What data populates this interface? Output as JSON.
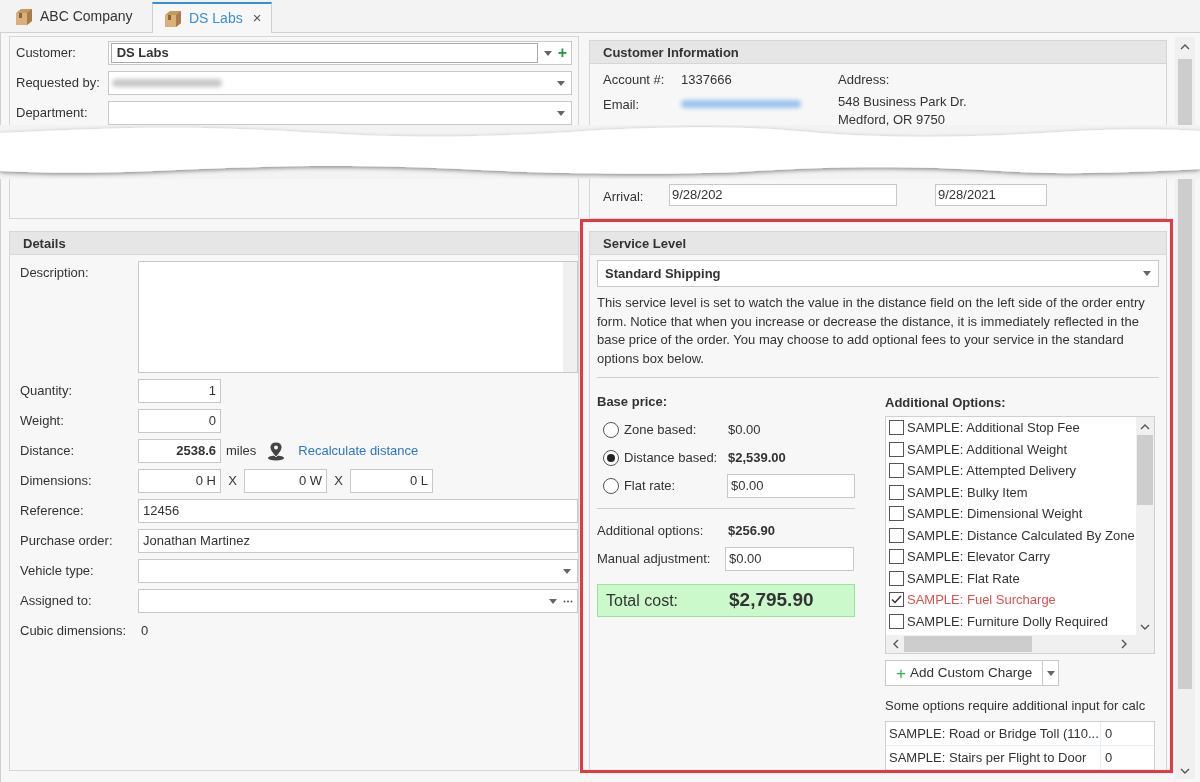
{
  "tabs": [
    {
      "label": "ABC Company",
      "selected": false
    },
    {
      "label": "DS Labs",
      "selected": true,
      "close": "×"
    }
  ],
  "order_header": {
    "fields": [
      {
        "label": "Customer:",
        "kind": "customer",
        "value": "DS Labs",
        "add": "+"
      },
      {
        "label": "Requested by:",
        "kind": "redacted"
      },
      {
        "label": "Department:",
        "kind": "combo"
      }
    ]
  },
  "customer_information": {
    "title": "Customer Information",
    "account_label": "Account #:",
    "account": "1337666",
    "email_label": "Email:",
    "address_label": "Address:",
    "address_lines": [
      "548 Business Park Dr.",
      "Medford, OR 9750"
    ]
  },
  "dates": {
    "arrival_label": "Arrival:",
    "arrival": "9/28/202",
    "second": "9/28/2021"
  },
  "details": {
    "title": "Details",
    "rows": [
      {
        "label": "Description:",
        "kind": "textarea"
      },
      {
        "label": "Quantity:",
        "kind": "number",
        "value": "1"
      },
      {
        "label": "Weight:",
        "kind": "number",
        "value": "0"
      },
      {
        "label": "Distance:",
        "kind": "distance",
        "value": "2538.6",
        "unit": "miles",
        "link": "Recalculate distance"
      },
      {
        "label": "Dimensions:",
        "kind": "dimensions",
        "values": [
          "0 H",
          "0 W",
          "0 L"
        ],
        "separators": [
          "X",
          "X"
        ]
      },
      {
        "label": "Reference:",
        "kind": "text",
        "value": "12456"
      },
      {
        "label": "Purchase order:",
        "kind": "text",
        "value": "Jonathan Martinez"
      },
      {
        "label": "Vehicle type:",
        "kind": "combo"
      },
      {
        "label": "Assigned to:",
        "kind": "combo_more"
      },
      {
        "label": "Cubic dimensions:",
        "kind": "static",
        "value": "0"
      }
    ]
  },
  "service_level": {
    "title": "Service Level",
    "selected": "Standard Shipping",
    "description": "This service level is set to watch the value in the distance field on the left side of the order entry form. Notice that when you increase or decrease the distance, it is immediately reflected in the base price of the order. You may choose to add optional fees to your service in the standard options box below.",
    "base_price_label": "Base price:",
    "pricing": [
      {
        "label": "Zone based:",
        "selected": false,
        "kind": "static",
        "value": "$0.00"
      },
      {
        "label": "Distance based:",
        "selected": true,
        "kind": "static",
        "value": "$2,539.00"
      },
      {
        "label": "Flat rate:",
        "selected": false,
        "kind": "input",
        "value": "$0.00"
      }
    ],
    "additional_label": "Additional options:",
    "additional_value": "$256.90",
    "manual_label": "Manual adjustment:",
    "manual_value": "$0.00",
    "total_label": "Total cost:",
    "total_value": "$2,795.90",
    "options_title": "Additional Options:",
    "options": [
      {
        "label": "SAMPLE: Additional Stop Fee",
        "checked": false
      },
      {
        "label": "SAMPLE: Additional Weight",
        "checked": false
      },
      {
        "label": "SAMPLE: Attempted Delivery",
        "checked": false
      },
      {
        "label": "SAMPLE: Bulky Item",
        "checked": false
      },
      {
        "label": "SAMPLE: Dimensional Weight",
        "checked": false
      },
      {
        "label": "SAMPLE: Distance Calculated By Zone",
        "checked": false
      },
      {
        "label": "SAMPLE: Elevator Carry",
        "checked": false
      },
      {
        "label": "SAMPLE: Flat Rate",
        "checked": false
      },
      {
        "label": "SAMPLE: Fuel Surcharge",
        "checked": true
      },
      {
        "label": "SAMPLE: Furniture Dolly Required",
        "checked": false
      }
    ],
    "add_button": "Add Custom Charge",
    "add_glyph": "+",
    "input_note": "Some options require additional input for calc",
    "inputs": [
      {
        "name": "SAMPLE: Road or Bridge Toll (110...",
        "value": "0"
      },
      {
        "name": "SAMPLE: Stairs per Flight to Door",
        "value": "0"
      }
    ]
  }
}
